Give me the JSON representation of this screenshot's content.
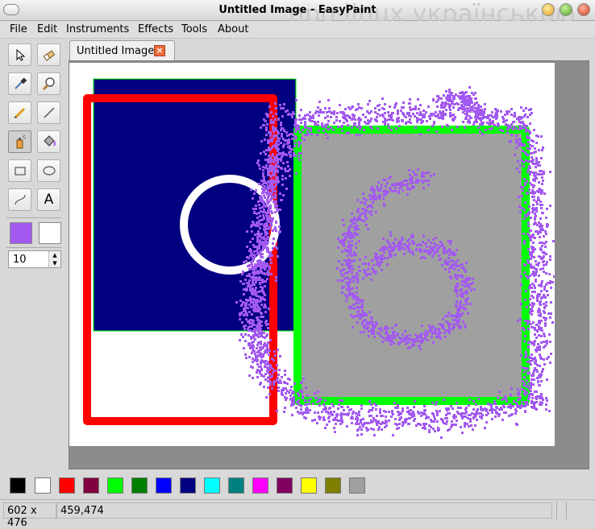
{
  "window": {
    "title": "Untitled Image - EasyPaint",
    "watermark": "про linux українською"
  },
  "menu": {
    "items": [
      {
        "label": "File"
      },
      {
        "label": "Edit"
      },
      {
        "label": "Instruments"
      },
      {
        "label": "Effects"
      },
      {
        "label": "Tools"
      },
      {
        "label": "About"
      }
    ]
  },
  "tools": [
    {
      "name": "cursor-tool",
      "icon": "cursor-icon"
    },
    {
      "name": "eraser-tool",
      "icon": "eraser-icon"
    },
    {
      "name": "color-picker-tool",
      "icon": "pipette-icon"
    },
    {
      "name": "magnifier-tool",
      "icon": "magnifier-icon"
    },
    {
      "name": "pencil-tool",
      "icon": "pencil-icon"
    },
    {
      "name": "line-tool",
      "icon": "line-icon"
    },
    {
      "name": "spray-tool",
      "icon": "spray-icon"
    },
    {
      "name": "fill-tool",
      "icon": "paint-bucket-icon"
    },
    {
      "name": "rectangle-tool",
      "icon": "rectangle-icon"
    },
    {
      "name": "ellipse-tool",
      "icon": "ellipse-icon"
    },
    {
      "name": "curve-tool",
      "icon": "curve-icon"
    },
    {
      "name": "text-tool",
      "icon": "text-icon",
      "label": "A"
    }
  ],
  "colors": {
    "primary": "#a259f0",
    "secondary": "#ffffff"
  },
  "pen_size": {
    "value": "10"
  },
  "tab": {
    "label": "Untitled Image",
    "close": "×"
  },
  "palette": [
    "#000000",
    "#ffffff",
    "#ff0000",
    "#800040",
    "#00ff00",
    "#008000",
    "#0000ff",
    "#000080",
    "#00ffff",
    "#008080",
    "#ff00ff",
    "#800060",
    "#ffff00",
    "#808000",
    "#a0a0a0"
  ],
  "status": {
    "size": "602 x 476",
    "position": "459,474"
  }
}
